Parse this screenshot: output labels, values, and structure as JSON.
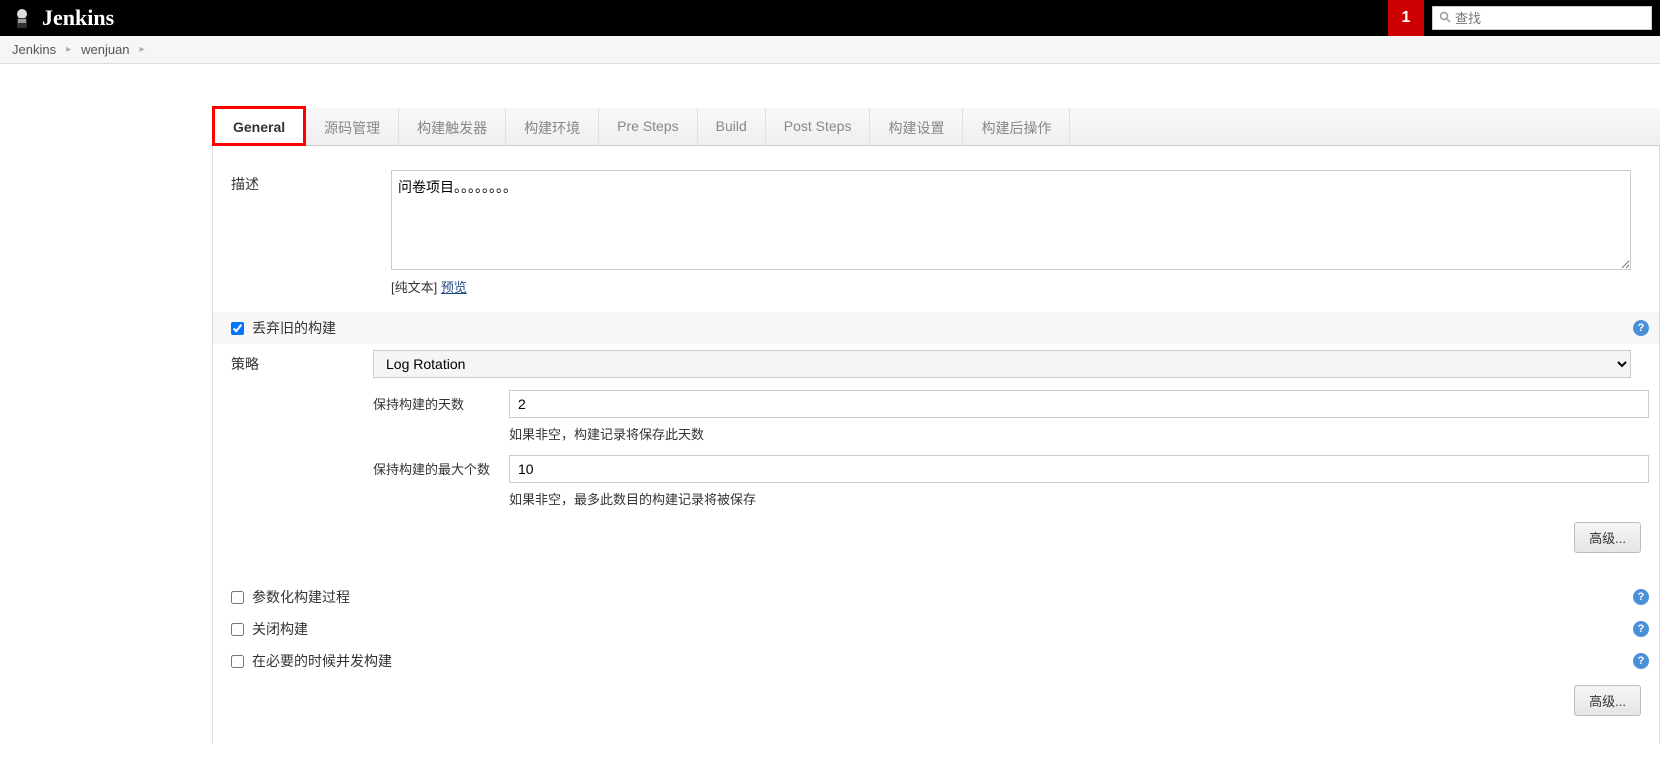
{
  "header": {
    "logo_text": "Jenkins",
    "notification_count": "1",
    "search_placeholder": "查找"
  },
  "breadcrumb": {
    "items": [
      "Jenkins",
      "wenjuan"
    ]
  },
  "tabs": [
    {
      "label": "General",
      "active": true
    },
    {
      "label": "源码管理",
      "active": false
    },
    {
      "label": "构建触发器",
      "active": false
    },
    {
      "label": "构建环境",
      "active": false
    },
    {
      "label": "Pre Steps",
      "active": false
    },
    {
      "label": "Build",
      "active": false
    },
    {
      "label": "Post Steps",
      "active": false
    },
    {
      "label": "构建设置",
      "active": false
    },
    {
      "label": "构建后操作",
      "active": false
    }
  ],
  "form": {
    "description_label": "描述",
    "description_value": "问卷项目。。。。。。。。",
    "plain_text_label": "[纯文本]",
    "preview_label": "预览",
    "discard_old_builds": {
      "label": "丢弃旧的构建",
      "checked": true
    },
    "strategy": {
      "label": "策略",
      "value": "Log Rotation"
    },
    "days_to_keep": {
      "label": "保持构建的天数",
      "value": "2",
      "hint": "如果非空，构建记录将保存此天数"
    },
    "max_to_keep": {
      "label": "保持构建的最大个数",
      "value": "10",
      "hint": "如果非空，最多此数目的构建记录将被保存"
    },
    "advanced_button": "高级...",
    "parameterized": {
      "label": "参数化构建过程",
      "checked": false
    },
    "disable_build": {
      "label": "关闭构建",
      "checked": false
    },
    "concurrent_build": {
      "label": "在必要的时候并发构建",
      "checked": false
    }
  }
}
